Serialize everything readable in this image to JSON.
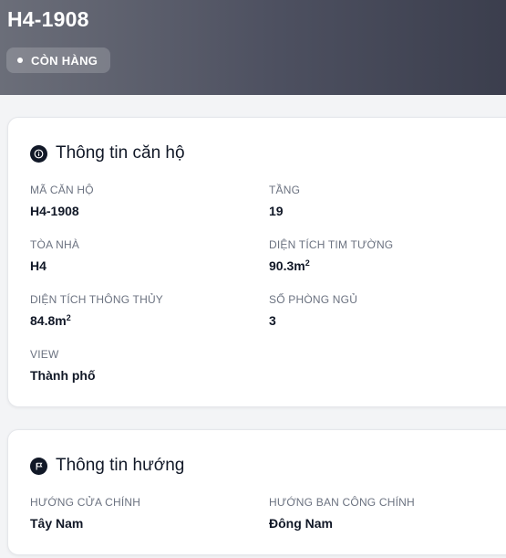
{
  "header": {
    "unit_code": "H4-1908",
    "status": "CÒN HÀNG"
  },
  "apartment_info": {
    "title": "Thông tin căn hộ",
    "icon": "info-circle-icon",
    "fields": [
      {
        "label": "MÃ CĂN HỘ",
        "value": "H4-1908"
      },
      {
        "label": "TẦNG",
        "value": "19"
      },
      {
        "label": "TÒA NHÀ",
        "value": "H4"
      },
      {
        "label": "DIỆN TÍCH TIM TƯỜNG",
        "value": "90.3m",
        "unit_sup": "2"
      },
      {
        "label": "DIỆN TÍCH THÔNG THỦY",
        "value": "84.8m",
        "unit_sup": "2"
      },
      {
        "label": "SỐ PHÒNG NGỦ",
        "value": "3"
      },
      {
        "label": "VIEW",
        "value": "Thành phố"
      }
    ]
  },
  "direction_info": {
    "title": "Thông tin hướng",
    "icon": "flag-circle-icon",
    "fields": [
      {
        "label": "HƯỚNG CỬA CHÍNH",
        "value": "Tây Nam"
      },
      {
        "label": "HƯỚNG BAN CÔNG CHÍNH",
        "value": "Đông Nam"
      }
    ]
  },
  "colors": {
    "header_gradient_start": "#6b6e79",
    "header_gradient_end": "#3b3e4d",
    "label": "#6b7280",
    "text": "#111827"
  }
}
